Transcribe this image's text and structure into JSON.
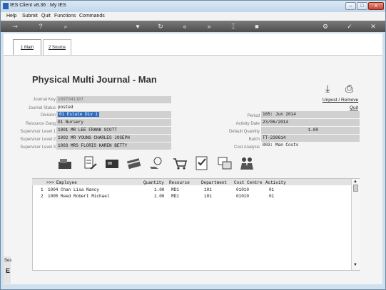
{
  "window": {
    "title": "IES Client v8.36 : My IES"
  },
  "menu": [
    "Help",
    "Submit",
    "Quit",
    "Functions",
    "Commands"
  ],
  "tabs": [
    {
      "label": "1 Main"
    },
    {
      "label": "2 Source"
    }
  ],
  "page_title": "Physical Multi Journal - Man",
  "actions": {
    "unpost_remove": "Unpost / Remove",
    "quit": "Quit"
  },
  "fields_left": [
    {
      "label": "Journal Key",
      "value": "1697041107"
    },
    {
      "label": "Journal Status",
      "value": "posted"
    },
    {
      "label": "Division",
      "value": "01 Estate Div 1"
    },
    {
      "label": "Resource Gang",
      "value": "01 Nursery"
    },
    {
      "label": "Supervisor Level 1",
      "value": "1001 MR LEE FRANK SCOTT"
    },
    {
      "label": "Supervisor Level 2",
      "value": "1002 MR YOUNG CHARLES JOSEPH"
    },
    {
      "label": "Supervisor Level 3",
      "value": "1003 MRS FLORIS KAREN BETTY"
    }
  ],
  "fields_right": [
    {
      "label": "Period",
      "value": "165: Jun 2014"
    },
    {
      "label": "Activity Date",
      "value": "23/06/2014"
    },
    {
      "label": "Default Quantity",
      "value": "1.00"
    },
    {
      "label": "Batch",
      "value": "TT-230614"
    },
    {
      "label": "Cost Analysis",
      "value": "003: Man Costs"
    }
  ],
  "grid": {
    "headers": [
      ">>>",
      "Employee",
      "Quantity",
      "Resource",
      "Department",
      "Cost Centre",
      "Activity"
    ],
    "rows": [
      [
        "1",
        "1004 Chan Lisa Nancy",
        "1.00",
        "MD1",
        "101",
        "01010",
        "01"
      ],
      [
        "2",
        "1005 Reed Robert Michael",
        "1.00",
        "MD1",
        "101",
        "01010",
        "01"
      ]
    ]
  },
  "side_text": "Ses",
  "side_text2": "E",
  "colors": {
    "selection": "#2f6dc0",
    "toolbar": "#5c5c5c",
    "frame": "#cfe0ef"
  }
}
